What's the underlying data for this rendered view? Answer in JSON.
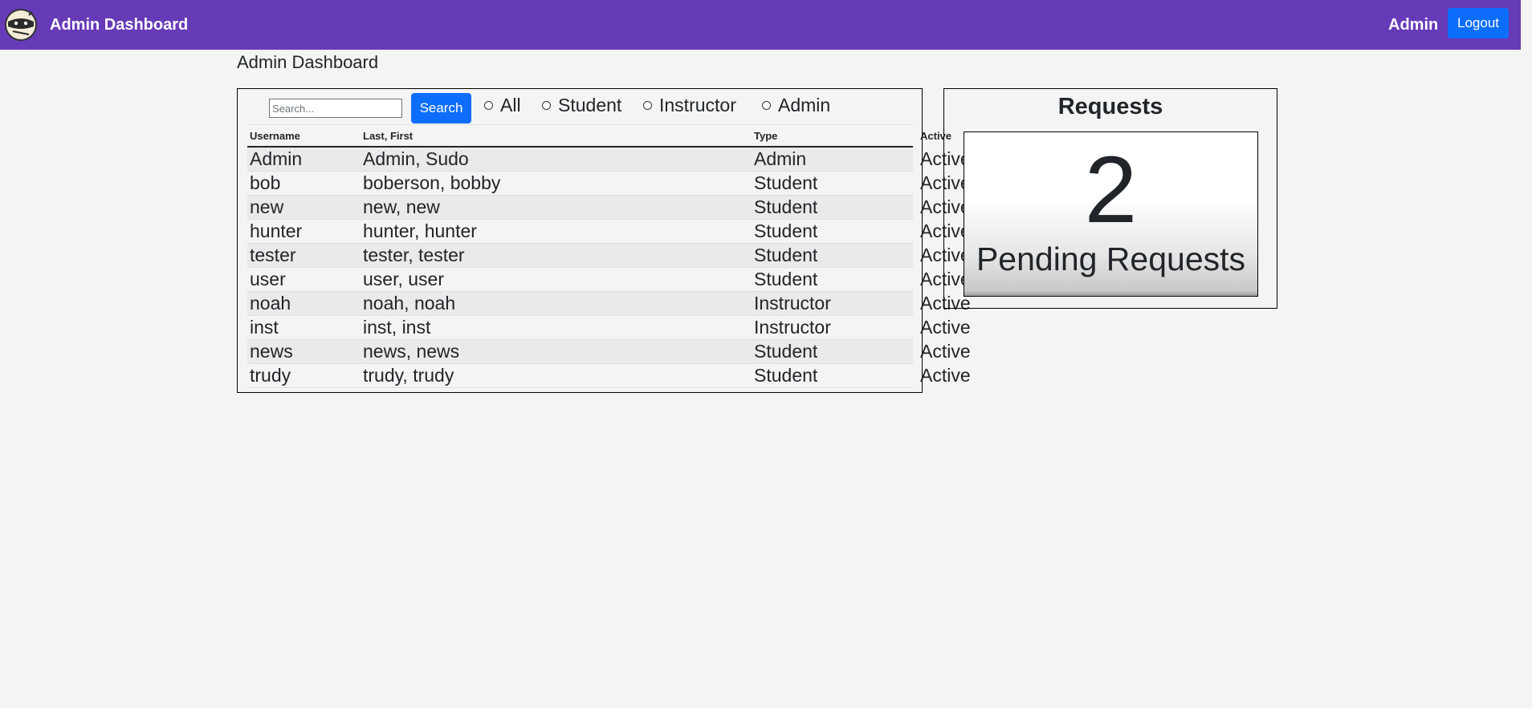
{
  "navbar": {
    "brand": "Admin Dashboard",
    "user": "Admin",
    "logout_label": "Logout",
    "logo_icon": "ninja-logo-icon",
    "color": "#673ab7"
  },
  "page": {
    "title": "Admin Dashboard"
  },
  "search": {
    "placeholder": "Search...",
    "button_label": "Search"
  },
  "filters": [
    "All",
    "Student",
    "Instructor",
    "Admin"
  ],
  "table": {
    "headers": [
      "Username",
      "Last, First",
      "Type",
      "Active"
    ],
    "rows": [
      [
        "Admin",
        "Admin, Sudo",
        "Admin",
        "Active"
      ],
      [
        "bob",
        "boberson, bobby",
        "Student",
        "Active"
      ],
      [
        "new",
        "new, new",
        "Student",
        "Active"
      ],
      [
        "hunter",
        "hunter, hunter",
        "Student",
        "Active"
      ],
      [
        "tester",
        "tester, tester",
        "Student",
        "Active"
      ],
      [
        "user",
        "user, user",
        "Student",
        "Active"
      ],
      [
        "noah",
        "noah, noah",
        "Instructor",
        "Active"
      ],
      [
        "inst",
        "inst, inst",
        "Instructor",
        "Active"
      ],
      [
        "news",
        "news, news",
        "Student",
        "Active"
      ],
      [
        "trudy",
        "trudy, trudy",
        "Student",
        "Active"
      ]
    ]
  },
  "requests": {
    "title": "Requests",
    "count": "2",
    "label": "Pending Requests"
  },
  "colors": {
    "primary_button": "#0d6efd",
    "background": "#f4f4f4"
  }
}
